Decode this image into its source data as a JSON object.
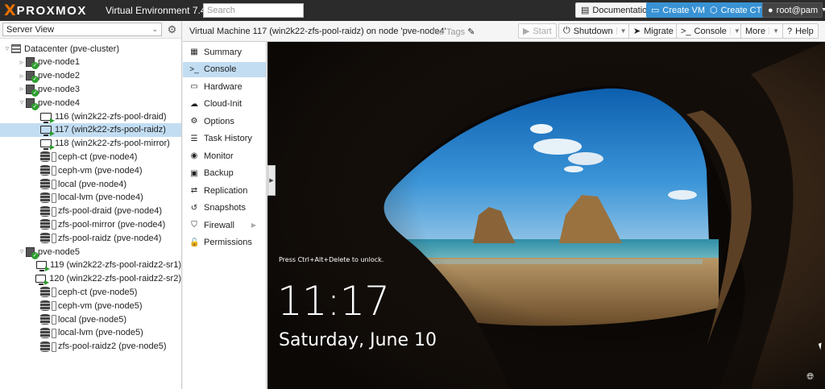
{
  "topbar": {
    "logo_x": "X",
    "logo_word": "PROXMOX",
    "version": "Virtual Environment 7.4-3",
    "search_placeholder": "Search",
    "documentation": "Documentation",
    "create_vm": "Create VM",
    "create_ct": "Create CT",
    "user": "root@pam"
  },
  "tree": {
    "view": "Server View",
    "rows": [
      {
        "label": "Datacenter (pve-cluster)",
        "type": "datacenter",
        "level": 0,
        "toggle": "▿"
      },
      {
        "label": "pve-node1",
        "type": "node",
        "level": 1,
        "toggle": "▹"
      },
      {
        "label": "pve-node2",
        "type": "node",
        "level": 1,
        "toggle": "▹"
      },
      {
        "label": "pve-node3",
        "type": "node",
        "level": 1,
        "toggle": "▹"
      },
      {
        "label": "pve-node4",
        "type": "node",
        "level": 1,
        "toggle": "▿"
      },
      {
        "label": "116 (win2k22-zfs-pool-draid)",
        "type": "vm",
        "level": 2
      },
      {
        "label": "117 (win2k22-zfs-pool-raidz)",
        "type": "vm",
        "level": 2,
        "selected": true
      },
      {
        "label": "118 (win2k22-zfs-pool-mirror)",
        "type": "vm",
        "level": 2
      },
      {
        "label": "ceph-ct (pve-node4)",
        "type": "storage",
        "level": 2
      },
      {
        "label": "ceph-vm (pve-node4)",
        "type": "storage",
        "level": 2
      },
      {
        "label": "local (pve-node4)",
        "type": "storage",
        "level": 2
      },
      {
        "label": "local-lvm (pve-node4)",
        "type": "storage",
        "level": 2
      },
      {
        "label": "zfs-pool-draid (pve-node4)",
        "type": "storage",
        "level": 2
      },
      {
        "label": "zfs-pool-mirror (pve-node4)",
        "type": "storage",
        "level": 2
      },
      {
        "label": "zfs-pool-raidz (pve-node4)",
        "type": "storage",
        "level": 2
      },
      {
        "label": "pve-node5",
        "type": "node",
        "level": 1,
        "toggle": "▿"
      },
      {
        "label": "119 (win2k22-zfs-pool-raidz2-sr1)",
        "type": "vm",
        "level": 2
      },
      {
        "label": "120 (win2k22-zfs-pool-raidz2-sr2)",
        "type": "vm",
        "level": 2
      },
      {
        "label": "ceph-ct (pve-node5)",
        "type": "storage",
        "level": 2
      },
      {
        "label": "ceph-vm (pve-node5)",
        "type": "storage",
        "level": 2
      },
      {
        "label": "local (pve-node5)",
        "type": "storage",
        "level": 2
      },
      {
        "label": "local-lvm (pve-node5)",
        "type": "storage",
        "level": 2
      },
      {
        "label": "zfs-pool-raidz2 (pve-node5)",
        "type": "storage",
        "level": 2
      }
    ]
  },
  "header": {
    "title": "Virtual Machine 117 (win2k22-zfs-pool-raidz) on node 'pve-node4'",
    "tags": "No Tags",
    "start": "Start",
    "shutdown": "Shutdown",
    "migrate": "Migrate",
    "console": "Console",
    "more": "More",
    "help": "Help"
  },
  "submenu": [
    {
      "label": "Summary",
      "icon": "▦"
    },
    {
      "label": "Console",
      "icon": ">_",
      "active": true
    },
    {
      "label": "Hardware",
      "icon": "▭"
    },
    {
      "label": "Cloud-Init",
      "icon": "☁"
    },
    {
      "label": "Options",
      "icon": "⚙"
    },
    {
      "label": "Task History",
      "icon": "☰"
    },
    {
      "label": "Monitor",
      "icon": "◉"
    },
    {
      "label": "Backup",
      "icon": "▣"
    },
    {
      "label": "Replication",
      "icon": "⇄"
    },
    {
      "label": "Snapshots",
      "icon": "↺"
    },
    {
      "label": "Firewall",
      "icon": "⛉",
      "arrow": true
    },
    {
      "label": "Permissions",
      "icon": "🔓"
    }
  ],
  "console": {
    "hint": "Press Ctrl+Alt+Delete to unlock.",
    "time": "11:17",
    "date": "Saturday, June 10"
  },
  "colors": {
    "topbar_bg": "#2b2b2b",
    "logo_accent": "#e57000",
    "primary_button": "#3892d4",
    "selection": "#c2ddf2",
    "status_ok": "#2e9e2e"
  }
}
